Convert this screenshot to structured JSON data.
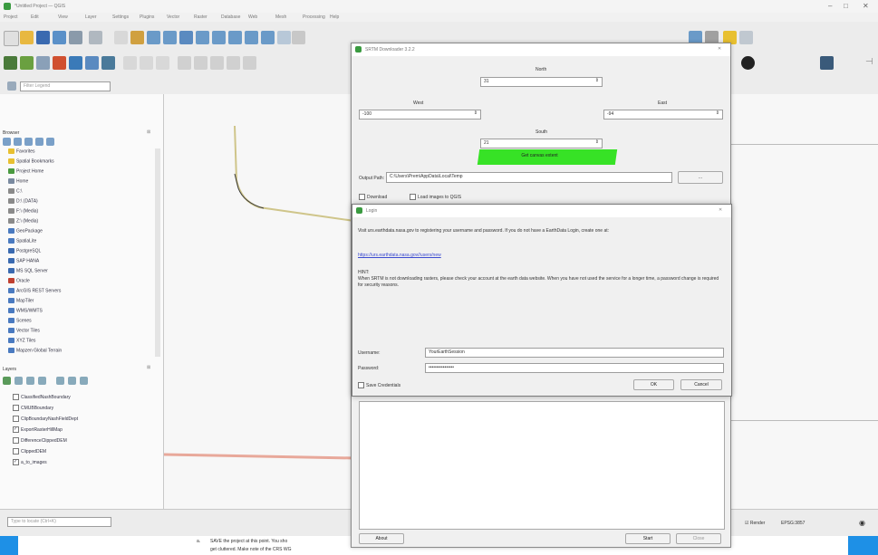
{
  "window": {
    "title": "*Untitled Project — QGIS",
    "menu": [
      "Project",
      "Edit",
      "View",
      "Layer",
      "Settings",
      "Plugins",
      "Vector",
      "Raster",
      "Database",
      "Web",
      "Mesh",
      "Processing",
      "Help"
    ]
  },
  "browser_panel": {
    "title": "Browser",
    "items": [
      {
        "label": "Favorites",
        "color": "#e8c030"
      },
      {
        "label": "Spatial Bookmarks",
        "color": "#e8c030"
      },
      {
        "label": "Project Home",
        "color": "#4a9a40"
      },
      {
        "label": "Home",
        "color": "#7a8aa0"
      },
      {
        "label": "C:\\",
        "color": "#8a8a8a"
      },
      {
        "label": "D:\\ (DATA)",
        "color": "#8a8a8a"
      },
      {
        "label": "F:\\ (Media)",
        "color": "#8a8a8a"
      },
      {
        "label": "Z:\\ (Media)",
        "color": "#8a8a8a"
      },
      {
        "label": "GeoPackage",
        "color": "#4a7ac0"
      },
      {
        "label": "SpatiaLite",
        "color": "#4a7ac0"
      },
      {
        "label": "PostgreSQL",
        "color": "#3a6ab0"
      },
      {
        "label": "SAP HANA",
        "color": "#3a6ab0"
      },
      {
        "label": "MS SQL Server",
        "color": "#3a6ab0"
      },
      {
        "label": "Oracle",
        "color": "#c04030"
      },
      {
        "label": "ArcGIS REST Servers",
        "color": "#4a7ac0"
      },
      {
        "label": "MapTiler",
        "color": "#4a7ac0"
      },
      {
        "label": "WMS/WMTS",
        "color": "#4a7ac0"
      },
      {
        "label": "Scenes",
        "color": "#4a7ac0"
      },
      {
        "label": "Vector Tiles",
        "color": "#4a7ac0"
      },
      {
        "label": "XYZ Tiles",
        "color": "#4a7ac0"
      },
      {
        "label": "Mapzen Global Terrain",
        "color": "#4a7ac0"
      }
    ]
  },
  "layers_panel": {
    "title": "Layers",
    "items": [
      {
        "label": "ClassifiedNashBoundary",
        "checked": false
      },
      {
        "label": "CMUBBoundary",
        "checked": false
      },
      {
        "label": "ClipBoundaryNashFieldDept",
        "checked": false
      },
      {
        "label": "ExportRasterHillMap",
        "checked": true
      },
      {
        "label": "DifferenceClippedDEM",
        "checked": false
      },
      {
        "label": "ClippedDEM",
        "checked": false
      },
      {
        "label": "a_to_images",
        "checked": true
      }
    ]
  },
  "search": {
    "placeholder": "Type to locate (Ctrl+K)",
    "filter_placeholder": "Filter Legend"
  },
  "status_bar": {
    "render_label": "Render",
    "crs": "EPSG:3857"
  },
  "opentopo_dialog": {
    "title": "SRTM Downloader 3.2.2",
    "north_label": "North",
    "north_value": "31",
    "west_label": "West",
    "west_value": "-100",
    "east_label": "East",
    "east_value": "-94",
    "south_label": "South",
    "south_value": "21",
    "highlight_text": "Get canvas extent",
    "output_path_label": "Output Path:",
    "output_path_value": "C:\\Users\\Prem\\AppData\\Local\\Temp",
    "browse_label": "...",
    "download_label": "Download",
    "load_label": "Load images to QGIS",
    "about_label": "About",
    "start_label": "Start",
    "close_label": "Close"
  },
  "login_dialog": {
    "title": "Login",
    "intro": "Visit urs.earthdata.nasa.gov to registering your username and password. If you do not have a EarthData Login, create one at:",
    "link": "https://urs.earthdata.nasa.gov//users/new",
    "hint_title": "HINT:",
    "hint_text": "When SRTM is not downloading rasters, please check your account at the earth data website. When you have not used the service for a longer time, a password change is required for security reasons.",
    "username_label": "Username:",
    "username_value": "YourEarthSession",
    "password_label": "Password:",
    "password_value": "••••••••••••••••",
    "save_label": "Save Credentials",
    "ok_label": "OK",
    "cancel_label": "Cancel"
  },
  "document_snippet": {
    "item_marker": "a.",
    "line1": "SAVE the project at this point. You sho",
    "line2": "get cluttered. Make note of the CRS WG"
  }
}
